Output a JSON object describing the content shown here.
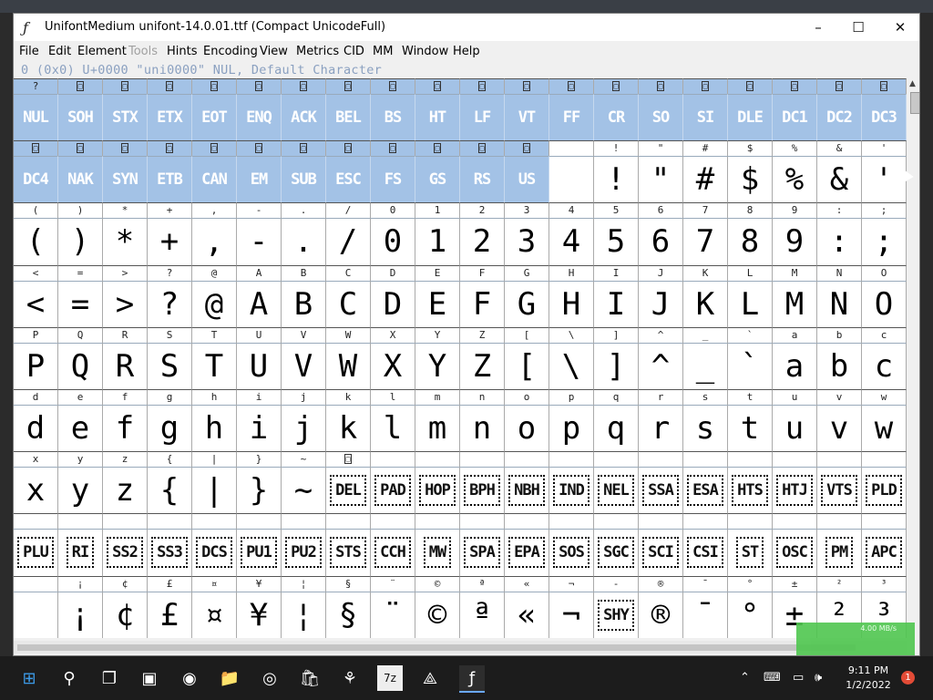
{
  "window": {
    "title": "UnifontMedium  unifont-14.0.01.ttf (Compact UnicodeFull)",
    "app_icon": "fontforge-icon",
    "controls": [
      "–",
      "☐",
      "✕"
    ]
  },
  "menu": [
    {
      "label": "File",
      "disabled": false
    },
    {
      "label": "Edit",
      "disabled": false
    },
    {
      "label": "Element",
      "disabled": false
    },
    {
      "label": "Tools",
      "disabled": true
    },
    {
      "label": "Hints",
      "disabled": false
    },
    {
      "label": "Encoding",
      "disabled": false
    },
    {
      "label": "View",
      "disabled": false
    },
    {
      "label": "Metrics",
      "disabled": false
    },
    {
      "label": "CID",
      "disabled": false
    },
    {
      "label": "MM",
      "disabled": false
    },
    {
      "label": "Window",
      "disabled": false
    },
    {
      "label": "Help",
      "disabled": false
    }
  ],
  "info": "0 (0x0) U+0000 \"uni0000\" NUL, Default Character",
  "grid": {
    "rows": [
      {
        "labels": [
          "?",
          "□",
          "□",
          "□",
          "□",
          "□",
          "□",
          "□",
          "□",
          "□",
          "□",
          "□",
          "□",
          "□",
          "□",
          "□",
          "□",
          "□",
          "□",
          "□"
        ],
        "glyphs": [
          "NUL",
          "SOH",
          "STX",
          "ETX",
          "EOT",
          "ENQ",
          "ACK",
          "BEL",
          "BS",
          "HT",
          "LF",
          "VT",
          "FF",
          "CR",
          "SO",
          "SI",
          "DLE",
          "DC1",
          "DC2",
          "DC3"
        ],
        "kind": [
          "sel",
          "sel",
          "sel",
          "sel",
          "sel",
          "sel",
          "sel",
          "sel",
          "sel",
          "sel",
          "sel",
          "sel",
          "sel",
          "sel",
          "sel",
          "sel",
          "sel",
          "sel",
          "sel",
          "sel"
        ]
      },
      {
        "labels": [
          "□",
          "□",
          "□",
          "□",
          "□",
          "□",
          "□",
          "□",
          "□",
          "□",
          "□",
          "□",
          "",
          "!",
          "\"",
          "#",
          "$",
          "%",
          "&",
          "'"
        ],
        "glyphs": [
          "DC4",
          "NAK",
          "SYN",
          "ETB",
          "CAN",
          "EM",
          "SUB",
          "ESC",
          "FS",
          "GS",
          "RS",
          "US",
          "",
          "!",
          "\"",
          "#",
          "$",
          "%",
          "&",
          "'"
        ],
        "kind": [
          "sel",
          "sel",
          "sel",
          "sel",
          "sel",
          "sel",
          "sel",
          "sel",
          "sel",
          "sel",
          "sel",
          "sel",
          "",
          "",
          "",
          "",
          "",
          "",
          "",
          ""
        ]
      },
      {
        "labels": [
          "(",
          ")",
          "*",
          "+",
          ",",
          "-",
          ".",
          "/",
          "0",
          "1",
          "2",
          "3",
          "4",
          "5",
          "6",
          "7",
          "8",
          "9",
          ":",
          ";"
        ],
        "glyphs": [
          "(",
          ")",
          "*",
          "+",
          ",",
          "-",
          ".",
          "/",
          "0",
          "1",
          "2",
          "3",
          "4",
          "5",
          "6",
          "7",
          "8",
          "9",
          ":",
          ";"
        ],
        "kind": []
      },
      {
        "labels": [
          "<",
          "=",
          ">",
          "?",
          "@",
          "A",
          "B",
          "C",
          "D",
          "E",
          "F",
          "G",
          "H",
          "I",
          "J",
          "K",
          "L",
          "M",
          "N",
          "O"
        ],
        "glyphs": [
          "<",
          "=",
          ">",
          "?",
          "@",
          "A",
          "B",
          "C",
          "D",
          "E",
          "F",
          "G",
          "H",
          "I",
          "J",
          "K",
          "L",
          "M",
          "N",
          "O"
        ],
        "kind": []
      },
      {
        "labels": [
          "P",
          "Q",
          "R",
          "S",
          "T",
          "U",
          "V",
          "W",
          "X",
          "Y",
          "Z",
          "[",
          "\\",
          "]",
          "^",
          "_",
          "`",
          "a",
          "b",
          "c"
        ],
        "glyphs": [
          "P",
          "Q",
          "R",
          "S",
          "T",
          "U",
          "V",
          "W",
          "X",
          "Y",
          "Z",
          "[",
          "\\",
          "]",
          "^",
          "_",
          "`",
          "a",
          "b",
          "c"
        ],
        "kind": []
      },
      {
        "labels": [
          "d",
          "e",
          "f",
          "g",
          "h",
          "i",
          "j",
          "k",
          "l",
          "m",
          "n",
          "o",
          "p",
          "q",
          "r",
          "s",
          "t",
          "u",
          "v",
          "w"
        ],
        "glyphs": [
          "d",
          "e",
          "f",
          "g",
          "h",
          "i",
          "j",
          "k",
          "l",
          "m",
          "n",
          "o",
          "p",
          "q",
          "r",
          "s",
          "t",
          "u",
          "v",
          "w"
        ],
        "kind": []
      },
      {
        "labels": [
          "x",
          "y",
          "z",
          "{",
          "|",
          "}",
          "~",
          "□",
          "",
          "",
          "",
          "",
          "",
          "",
          "",
          "",
          "",
          "",
          "",
          ""
        ],
        "glyphs": [
          "x",
          "y",
          "z",
          "{",
          "|",
          "}",
          "~",
          "DEL",
          "PAD",
          "HOP",
          "BPH",
          "NBH",
          "IND",
          "NEL",
          "SSA",
          "ESA",
          "HTS",
          "HTJ",
          "VTS",
          "PLD"
        ],
        "kind": [
          "",
          "",
          "",
          "",
          "",
          "",
          "",
          "boxed",
          "boxed",
          "boxed",
          "boxed",
          "boxed",
          "boxed",
          "boxed",
          "boxed",
          "boxed",
          "boxed",
          "boxed",
          "boxed",
          "boxed"
        ]
      },
      {
        "labels": [
          "",
          "",
          "",
          "",
          "",
          "",
          "",
          "",
          "",
          "",
          "",
          "",
          "",
          "",
          "",
          "",
          "",
          "",
          "",
          ""
        ],
        "glyphs": [
          "PLU",
          "RI",
          "SS2",
          "SS3",
          "DCS",
          "PU1",
          "PU2",
          "STS",
          "CCH",
          "MW",
          "SPA",
          "EPA",
          "SOS",
          "SGC",
          "SCI",
          "CSI",
          "ST",
          "OSC",
          "PM",
          "APC"
        ],
        "kind": [
          "boxed",
          "boxed",
          "boxed",
          "boxed",
          "boxed",
          "boxed",
          "boxed",
          "boxed",
          "boxed",
          "boxed",
          "boxed",
          "boxed",
          "boxed",
          "boxed",
          "boxed",
          "boxed",
          "boxed",
          "boxed",
          "boxed",
          "boxed"
        ]
      },
      {
        "labels": [
          "",
          "¡",
          "¢",
          "£",
          "¤",
          "¥",
          "¦",
          "§",
          "¨",
          "©",
          "ª",
          "«",
          "¬",
          "-",
          "®",
          "¯",
          "°",
          "±",
          "²",
          "³"
        ],
        "glyphs": [
          "",
          "¡",
          "¢",
          "£",
          "¤",
          "¥",
          "¦",
          "§",
          "¨",
          "©",
          "ª",
          "«",
          "¬",
          "SHY",
          "®",
          "¯",
          "°",
          "±",
          "²",
          "³"
        ],
        "kind": [
          "",
          "",
          "",
          "",
          "",
          "",
          "",
          "",
          "",
          "",
          "",
          "",
          "",
          "boxed",
          "",
          "",
          "",
          "",
          "",
          ""
        ]
      }
    ]
  },
  "status": {
    "net_speed": "4.00 MB/s"
  },
  "taskbar": {
    "icons": [
      "start-icon",
      "search-icon",
      "task-view-icon",
      "windows-explorer-icon",
      "meet-icon",
      "folder-icon",
      "chrome-icon",
      "store-icon",
      "archive-icon",
      "7zip-icon",
      "fontforge-tool-icon",
      "fontforge-icon"
    ],
    "glyphs": [
      "⊞",
      "⚲",
      "❐",
      "▣",
      "◉",
      "📁",
      "◎",
      "🛍",
      "⚘",
      "7z",
      "⟁",
      "ƒ"
    ],
    "time": "9:11 PM",
    "date": "1/2/2022",
    "notifications": "1"
  }
}
